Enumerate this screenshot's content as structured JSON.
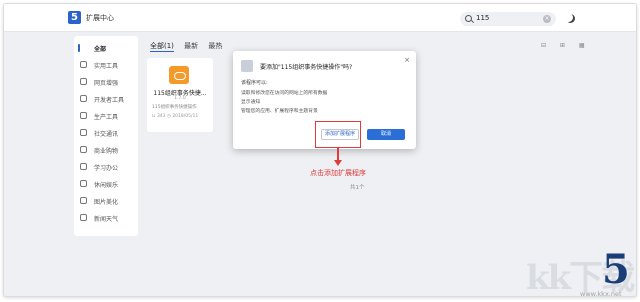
{
  "header": {
    "logo_glyph": "5",
    "app_title": "扩展中心",
    "search_value": "115",
    "clear_glyph": "×"
  },
  "sidebar": {
    "items": [
      {
        "label": "全部",
        "icon": "menu-bar-icon",
        "active": true
      },
      {
        "label": "实用工具",
        "icon": "tool-icon"
      },
      {
        "label": "网页增强",
        "icon": "window-icon"
      },
      {
        "label": "开发者工具",
        "icon": "code-icon"
      },
      {
        "label": "生产工具",
        "icon": "briefcase-icon"
      },
      {
        "label": "社交通讯",
        "icon": "chat-icon"
      },
      {
        "label": "商业购物",
        "icon": "shopping-icon"
      },
      {
        "label": "学习办公",
        "icon": "book-icon"
      },
      {
        "label": "休闲娱乐",
        "icon": "cup-icon"
      },
      {
        "label": "图片美化",
        "icon": "image-icon"
      },
      {
        "label": "新闻天气",
        "icon": "news-icon"
      }
    ]
  },
  "filters": {
    "all": "全部(1)",
    "newest": "最新",
    "hottest": "最热"
  },
  "view_icons": "⊟ ⊞ ▦",
  "card": {
    "name": "115组织事务快捷...",
    "version": "1.7.0",
    "description": "115组织事务快捷操作",
    "meta": "⊔ 343   ◷ 2018/05/11"
  },
  "total": "共1个",
  "dialog": {
    "title": "要添加\"115组织事务快捷操作\"吗?",
    "close_glyph": "×",
    "subtitle": "该程序可以:",
    "permissions": [
      "读取和修改您在访问的网站上的所有数据",
      "显示通知",
      "管理您的应用、扩展程序和主题背景"
    ],
    "add_button": "添加扩展程序",
    "cancel_button": "取消"
  },
  "annotation": "点击添加扩展程序",
  "watermark": {
    "text": "kk下载",
    "five": "5",
    "url": "www.kkx.net"
  },
  "colors": {
    "accent": "#2b63c9",
    "annotation_red": "#e03a3a",
    "card_icon": "#f39a2b"
  }
}
